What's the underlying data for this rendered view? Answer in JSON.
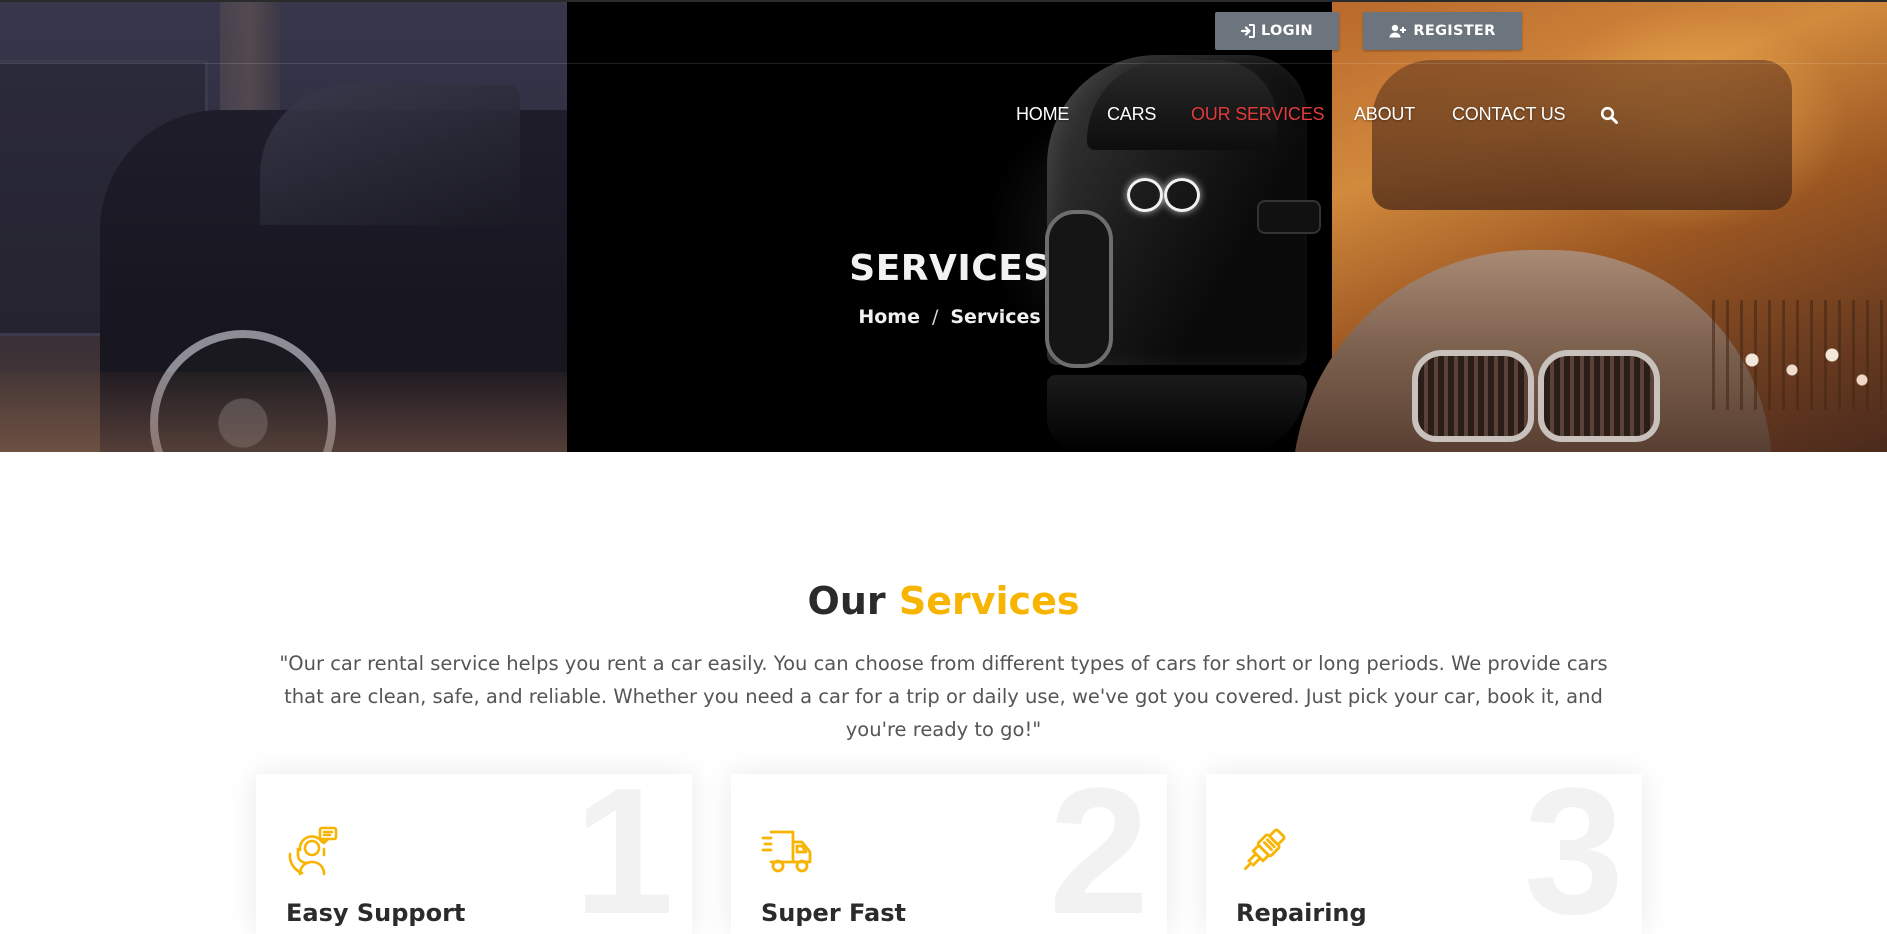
{
  "header": {
    "login_label": "LOGIN",
    "register_label": "REGISTER",
    "button_color": "#6c757d"
  },
  "nav": {
    "items": [
      {
        "label": "HOME",
        "active": false
      },
      {
        "label": "CARS",
        "active": false
      },
      {
        "label": "OUR SERVICES",
        "active": true
      },
      {
        "label": "ABOUT",
        "active": false
      },
      {
        "label": "CONTACT US",
        "active": false
      }
    ],
    "search_icon": "search-icon",
    "active_color": "#e23b3b"
  },
  "hero": {
    "title": "SERVICES",
    "breadcrumb": {
      "home": "Home",
      "separator": "/",
      "current": "Services"
    }
  },
  "services": {
    "title_main": "Our",
    "title_accent": "Services",
    "accent_color": "#f7b400",
    "description": "\"Our car rental service helps you rent a car easily. You can choose from different types of cars for short or long periods. We provide cars that are clean, safe, and reliable. Whether you need a car for a trip or daily use, we've got you covered. Just pick your car, book it, and you're ready to go!\"",
    "cards": [
      {
        "number": "1",
        "icon": "support-agent-icon",
        "title": "Easy Support"
      },
      {
        "number": "2",
        "icon": "delivery-truck-icon",
        "title": "Super Fast"
      },
      {
        "number": "3",
        "icon": "spark-plug-icon",
        "title": "Repairing"
      }
    ]
  }
}
